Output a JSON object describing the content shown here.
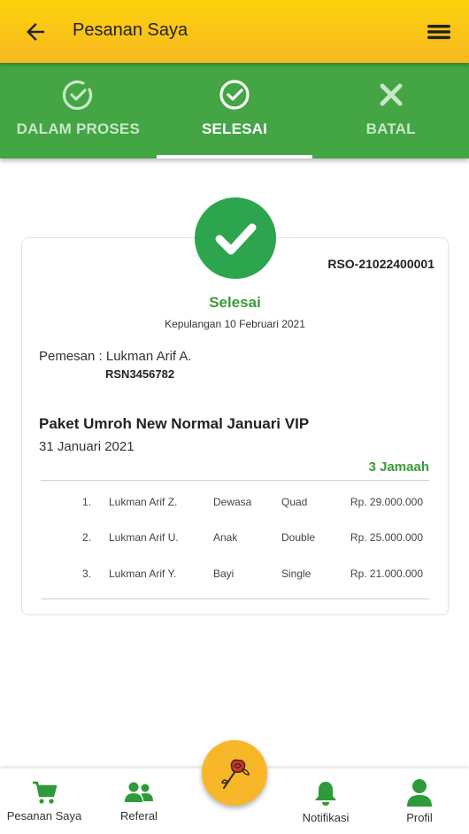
{
  "header": {
    "title": "Pesanan Saya",
    "back_icon": "arrow-left-icon",
    "menu_icon": "hamburger-menu-icon"
  },
  "tabs": [
    {
      "label": "DALAM PROSES",
      "icon": "check-circle-outline-icon",
      "active": false
    },
    {
      "label": "SELESAI",
      "icon": "check-circle-icon",
      "active": true
    },
    {
      "label": "BATAL",
      "icon": "close-icon",
      "active": false
    }
  ],
  "order": {
    "number": "RSO-21022400001",
    "status": "Selesai",
    "return_date": "Kepulangan 10 Februari 2021",
    "orderer": "Pemesan : Lukman Arif A.",
    "orderer_id": "RSN3456782",
    "package_name": "Paket Umroh New Normal Januari VIP",
    "package_date": "31 Januari 2021",
    "pilgrim_count": "3 Jamaah",
    "pilgrims": [
      {
        "no": "1.",
        "name": "Lukman Arif Z.",
        "age": "Dewasa",
        "room": "Quad",
        "price": "Rp. 29.000.000"
      },
      {
        "no": "2.",
        "name": "Lukman Arif U.",
        "age": "Anak",
        "room": "Double",
        "price": "Rp. 25.000.000"
      },
      {
        "no": "3.",
        "name": "Lukman Arif Y.",
        "age": "Bayi",
        "room": "Single",
        "price": "Rp. 21.000.000"
      }
    ]
  },
  "bottom_nav": [
    {
      "label": "Pesanan Saya",
      "icon": "cart-icon"
    },
    {
      "label": "Referal",
      "icon": "users-icon"
    },
    {
      "label": "Notifikasi",
      "icon": "bell-icon"
    },
    {
      "label": "Profil",
      "icon": "user-icon"
    }
  ],
  "fab_icon": "rose-icon",
  "colors": {
    "header_yellow": "#fbd20c",
    "tab_green": "#43a543",
    "status_green": "#3a9a3a",
    "fab_orange": "#f8b728"
  }
}
